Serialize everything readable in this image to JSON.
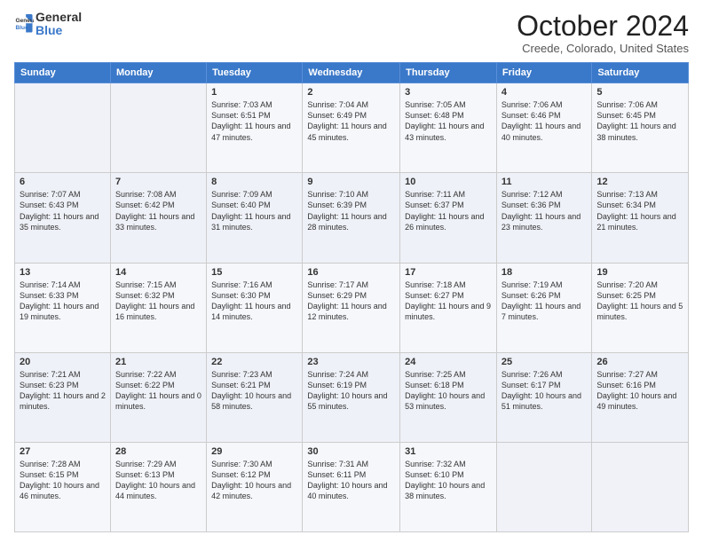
{
  "header": {
    "logo_line1": "General",
    "logo_line2": "Blue",
    "title": "October 2024",
    "subtitle": "Creede, Colorado, United States"
  },
  "days_of_week": [
    "Sunday",
    "Monday",
    "Tuesday",
    "Wednesday",
    "Thursday",
    "Friday",
    "Saturday"
  ],
  "weeks": [
    [
      {
        "day": "",
        "content": ""
      },
      {
        "day": "",
        "content": ""
      },
      {
        "day": "1",
        "content": "Sunrise: 7:03 AM\nSunset: 6:51 PM\nDaylight: 11 hours and 47 minutes."
      },
      {
        "day": "2",
        "content": "Sunrise: 7:04 AM\nSunset: 6:49 PM\nDaylight: 11 hours and 45 minutes."
      },
      {
        "day": "3",
        "content": "Sunrise: 7:05 AM\nSunset: 6:48 PM\nDaylight: 11 hours and 43 minutes."
      },
      {
        "day": "4",
        "content": "Sunrise: 7:06 AM\nSunset: 6:46 PM\nDaylight: 11 hours and 40 minutes."
      },
      {
        "day": "5",
        "content": "Sunrise: 7:06 AM\nSunset: 6:45 PM\nDaylight: 11 hours and 38 minutes."
      }
    ],
    [
      {
        "day": "6",
        "content": "Sunrise: 7:07 AM\nSunset: 6:43 PM\nDaylight: 11 hours and 35 minutes."
      },
      {
        "day": "7",
        "content": "Sunrise: 7:08 AM\nSunset: 6:42 PM\nDaylight: 11 hours and 33 minutes."
      },
      {
        "day": "8",
        "content": "Sunrise: 7:09 AM\nSunset: 6:40 PM\nDaylight: 11 hours and 31 minutes."
      },
      {
        "day": "9",
        "content": "Sunrise: 7:10 AM\nSunset: 6:39 PM\nDaylight: 11 hours and 28 minutes."
      },
      {
        "day": "10",
        "content": "Sunrise: 7:11 AM\nSunset: 6:37 PM\nDaylight: 11 hours and 26 minutes."
      },
      {
        "day": "11",
        "content": "Sunrise: 7:12 AM\nSunset: 6:36 PM\nDaylight: 11 hours and 23 minutes."
      },
      {
        "day": "12",
        "content": "Sunrise: 7:13 AM\nSunset: 6:34 PM\nDaylight: 11 hours and 21 minutes."
      }
    ],
    [
      {
        "day": "13",
        "content": "Sunrise: 7:14 AM\nSunset: 6:33 PM\nDaylight: 11 hours and 19 minutes."
      },
      {
        "day": "14",
        "content": "Sunrise: 7:15 AM\nSunset: 6:32 PM\nDaylight: 11 hours and 16 minutes."
      },
      {
        "day": "15",
        "content": "Sunrise: 7:16 AM\nSunset: 6:30 PM\nDaylight: 11 hours and 14 minutes."
      },
      {
        "day": "16",
        "content": "Sunrise: 7:17 AM\nSunset: 6:29 PM\nDaylight: 11 hours and 12 minutes."
      },
      {
        "day": "17",
        "content": "Sunrise: 7:18 AM\nSunset: 6:27 PM\nDaylight: 11 hours and 9 minutes."
      },
      {
        "day": "18",
        "content": "Sunrise: 7:19 AM\nSunset: 6:26 PM\nDaylight: 11 hours and 7 minutes."
      },
      {
        "day": "19",
        "content": "Sunrise: 7:20 AM\nSunset: 6:25 PM\nDaylight: 11 hours and 5 minutes."
      }
    ],
    [
      {
        "day": "20",
        "content": "Sunrise: 7:21 AM\nSunset: 6:23 PM\nDaylight: 11 hours and 2 minutes."
      },
      {
        "day": "21",
        "content": "Sunrise: 7:22 AM\nSunset: 6:22 PM\nDaylight: 11 hours and 0 minutes."
      },
      {
        "day": "22",
        "content": "Sunrise: 7:23 AM\nSunset: 6:21 PM\nDaylight: 10 hours and 58 minutes."
      },
      {
        "day": "23",
        "content": "Sunrise: 7:24 AM\nSunset: 6:19 PM\nDaylight: 10 hours and 55 minutes."
      },
      {
        "day": "24",
        "content": "Sunrise: 7:25 AM\nSunset: 6:18 PM\nDaylight: 10 hours and 53 minutes."
      },
      {
        "day": "25",
        "content": "Sunrise: 7:26 AM\nSunset: 6:17 PM\nDaylight: 10 hours and 51 minutes."
      },
      {
        "day": "26",
        "content": "Sunrise: 7:27 AM\nSunset: 6:16 PM\nDaylight: 10 hours and 49 minutes."
      }
    ],
    [
      {
        "day": "27",
        "content": "Sunrise: 7:28 AM\nSunset: 6:15 PM\nDaylight: 10 hours and 46 minutes."
      },
      {
        "day": "28",
        "content": "Sunrise: 7:29 AM\nSunset: 6:13 PM\nDaylight: 10 hours and 44 minutes."
      },
      {
        "day": "29",
        "content": "Sunrise: 7:30 AM\nSunset: 6:12 PM\nDaylight: 10 hours and 42 minutes."
      },
      {
        "day": "30",
        "content": "Sunrise: 7:31 AM\nSunset: 6:11 PM\nDaylight: 10 hours and 40 minutes."
      },
      {
        "day": "31",
        "content": "Sunrise: 7:32 AM\nSunset: 6:10 PM\nDaylight: 10 hours and 38 minutes."
      },
      {
        "day": "",
        "content": ""
      },
      {
        "day": "",
        "content": ""
      }
    ]
  ]
}
